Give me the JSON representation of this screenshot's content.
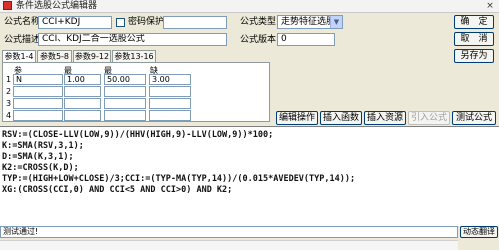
{
  "window": {
    "title": "条件选股公式编辑器",
    "close_glyph": "×"
  },
  "form": {
    "name_label": "公式名称",
    "name_value": "CCI+KDJ",
    "password_label": "密码保护",
    "desc_label": "公式描述",
    "desc_value": "CCI、KDJ二合一选股公式",
    "type_label": "公式类型",
    "type_value": "走势特征选股",
    "version_label": "公式版本",
    "version_value": "0"
  },
  "buttons": {
    "ok": "确　定",
    "cancel": "取　消",
    "save_as": "另存为",
    "edit_op": "编辑操作",
    "insert_func": "插入函数",
    "insert_res": "插入资源",
    "import_formula": "引入公式",
    "test_formula": "测试公式"
  },
  "tabs": [
    "参数1-4",
    "参数5-8",
    "参数9-12",
    "参数13-16"
  ],
  "params": {
    "headers": [
      "参数",
      "最小",
      "最大",
      "缺省"
    ],
    "rows": [
      {
        "num": "1",
        "name": "N",
        "min": "1.00",
        "max": "50.00",
        "default": "3.00"
      },
      {
        "num": "2",
        "name": "",
        "min": "",
        "max": "",
        "default": ""
      },
      {
        "num": "3",
        "name": "",
        "min": "",
        "max": "",
        "default": ""
      },
      {
        "num": "4",
        "name": "",
        "min": "",
        "max": "",
        "default": ""
      }
    ]
  },
  "code_lines": [
    "RSV:=(CLOSE-LLV(LOW,9))/(HHV(HIGH,9)-LLV(LOW,9))*100;",
    "K:=SMA(RSV,3,1);",
    "D:=SMA(K,3,1);",
    "K2:=CROSS(K,D);",
    "TYP:=(HIGH+LOW+CLOSE)/3;CCI:=(TYP-MA(TYP,14))/(0.015*AVEDEV(TYP,14));",
    "XG:(CROSS(CCI,0) AND CCI<5 AND CCI>0) AND K2;"
  ],
  "status": {
    "message": "测试通过!",
    "translate_label": "动态翻译"
  }
}
